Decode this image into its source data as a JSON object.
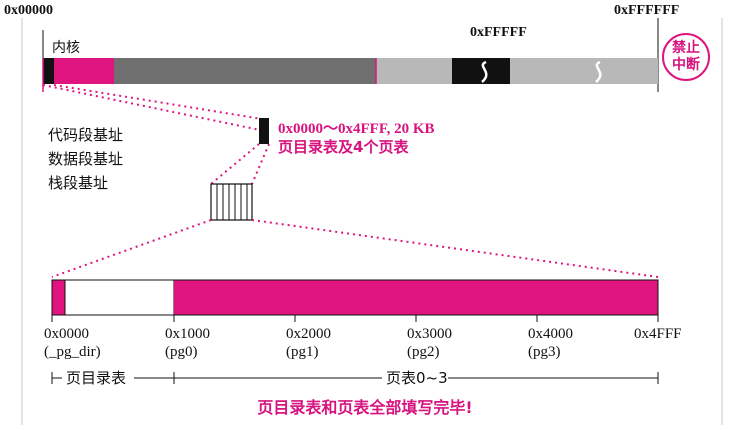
{
  "colors": {
    "magenta": "#e0147f",
    "black": "#111111",
    "dark_gray": "#6f6f6f",
    "light_gray": "#b8b8b8",
    "white": "#ffffff"
  },
  "top_bar": {
    "addr_start": "0x00000",
    "addr_fffff": "0xFFFFF",
    "addr_end": "0xFFFFFF",
    "kernel_label": "内核",
    "forbid_label_line1": "禁止",
    "forbid_label_line2": "中断",
    "segment_labels": [
      "代码段基址",
      "数据段基址",
      "栈段基址"
    ]
  },
  "callout": {
    "range_label": "0x0000～0x4FFF, 20 KB",
    "desc_label": "页目录表及4个页表"
  },
  "bottom_bar": {
    "ticks": [
      {
        "addr": "0x0000",
        "name": "(_pg_dir)"
      },
      {
        "addr": "0x1000",
        "name": "(pg0)"
      },
      {
        "addr": "0x2000",
        "name": "(pg1)"
      },
      {
        "addr": "0x3000",
        "name": "(pg2)"
      },
      {
        "addr": "0x4000",
        "name": "(pg3)"
      },
      {
        "addr": "0x4FFF",
        "name": ""
      }
    ],
    "span_pg_dir": "页目录表",
    "span_pg_tables": "页表0~3"
  },
  "footer": "页目录表和页表全部填写完毕!"
}
